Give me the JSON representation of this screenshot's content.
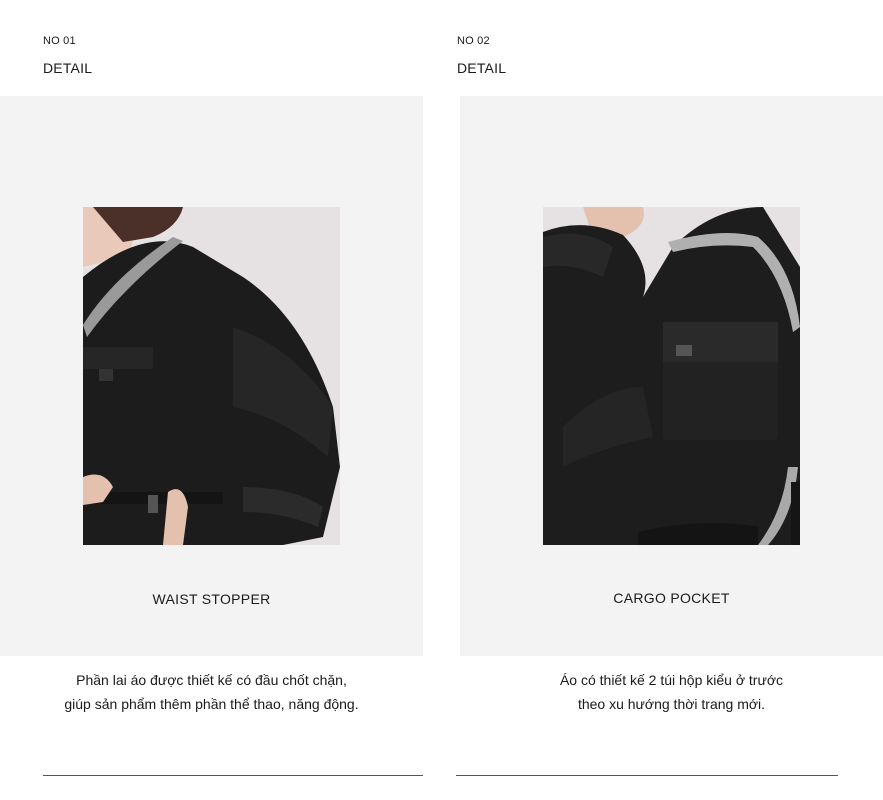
{
  "cards": [
    {
      "number": "NO 01",
      "heading": "DETAIL",
      "caption": "WAIST STOPPER",
      "description": [
        "Phần lai áo được thiết kế có đầu chốt chặn,",
        "giúp sản phẩm thêm phần thể thao, năng động."
      ]
    },
    {
      "number": "NO 02",
      "heading": "DETAIL",
      "caption": "CARGO POCKET",
      "description": [
        "Áo có thiết kế 2 túi hộp kiểu ở trước",
        "theo xu hướng thời trang mới."
      ]
    }
  ]
}
